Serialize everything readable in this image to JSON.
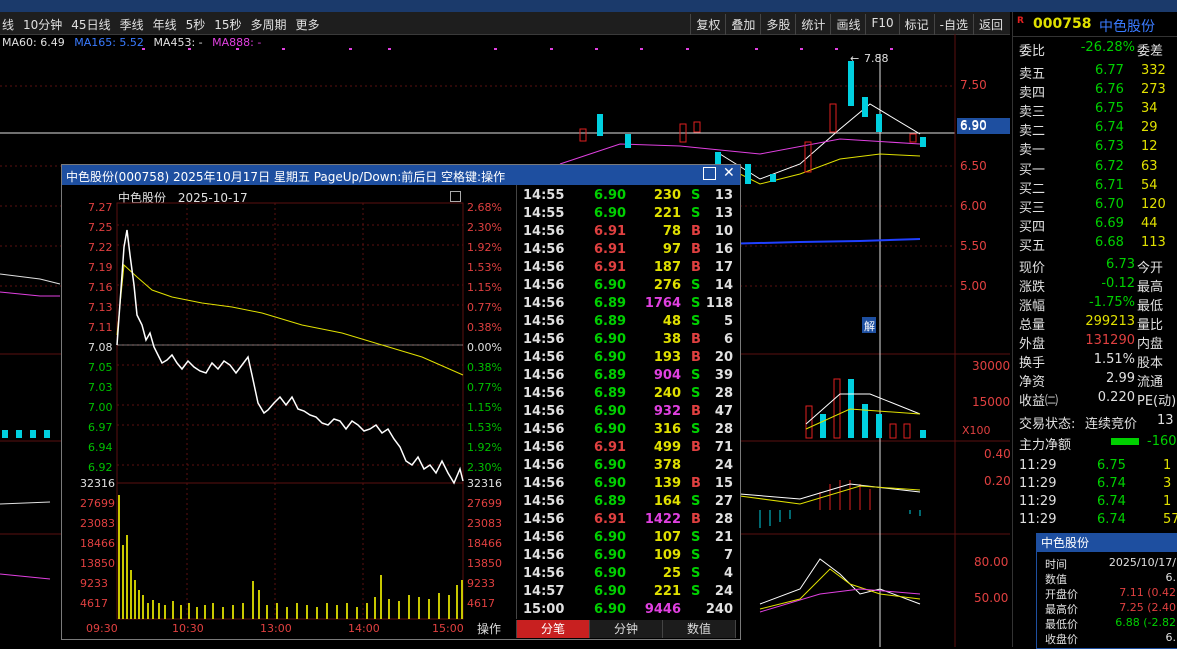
{
  "toolbar": {
    "left_items": [
      "线",
      "10分钟",
      "45日线",
      "季线",
      "年线",
      "5秒",
      "15秒",
      "多周期",
      "更多"
    ],
    "right_items": [
      "复权",
      "叠加",
      "多股",
      "统计",
      "画线",
      "F10",
      "标记",
      "-自选",
      "返回"
    ]
  },
  "ma_line": {
    "ma60": "MA60: 6.49",
    "ma165": "MA165: 5.52",
    "ma453": "MA453: -",
    "ma888": "MA888: -"
  },
  "main_chart": {
    "price_labels": [
      "7.50",
      "6.90",
      "6.50",
      "6.00",
      "5.50",
      "5.00"
    ],
    "high_label": "7.88",
    "vol_labels": [
      "30000",
      "15000",
      "X100"
    ],
    "macd_labels": [
      "0.40",
      "0.20"
    ],
    "kdj_labels": [
      "80.00",
      "50.00"
    ],
    "jie_label": "解"
  },
  "popup": {
    "title": "中色股份(000758) 2025年10月17日 星期五 PageUp/Down:前后日 空格键:操作",
    "subtitle_name": "中色股份",
    "subtitle_date": "2025-10-17",
    "left_prices": [
      "7.27",
      "7.25",
      "7.22",
      "7.19",
      "7.16",
      "7.13",
      "7.11",
      "7.08",
      "7.05",
      "7.03",
      "7.00",
      "6.97",
      "6.94",
      "6.92"
    ],
    "right_pcts": [
      "2.68%",
      "2.30%",
      "1.92%",
      "1.53%",
      "1.15%",
      "0.77%",
      "0.38%",
      "0.00%",
      "0.38%",
      "0.77%",
      "1.15%",
      "1.53%",
      "1.92%",
      "2.30%"
    ],
    "vol_labels": [
      "32316",
      "27699",
      "23083",
      "18466",
      "13850",
      "9233",
      "4617"
    ],
    "time_labels": [
      "09:30",
      "10:30",
      "13:00",
      "14:00",
      "15:00"
    ],
    "ticks": [
      [
        "14:55",
        "6.90",
        "230",
        "S",
        "13"
      ],
      [
        "14:55",
        "6.90",
        "221",
        "S",
        "13"
      ],
      [
        "14:56",
        "6.91",
        "78",
        "B",
        "10"
      ],
      [
        "14:56",
        "6.91",
        "97",
        "B",
        "16"
      ],
      [
        "14:56",
        "6.91",
        "187",
        "B",
        "17"
      ],
      [
        "14:56",
        "6.90",
        "276",
        "S",
        "14"
      ],
      [
        "14:56",
        "6.89",
        "1764",
        "S",
        "118"
      ],
      [
        "14:56",
        "6.89",
        "48",
        "S",
        "5"
      ],
      [
        "14:56",
        "6.90",
        "38",
        "B",
        "6"
      ],
      [
        "14:56",
        "6.90",
        "193",
        "B",
        "20"
      ],
      [
        "14:56",
        "6.89",
        "904",
        "S",
        "39"
      ],
      [
        "14:56",
        "6.89",
        "240",
        "S",
        "28"
      ],
      [
        "14:56",
        "6.90",
        "932",
        "B",
        "47"
      ],
      [
        "14:56",
        "6.90",
        "316",
        "S",
        "28"
      ],
      [
        "14:56",
        "6.91",
        "499",
        "B",
        "71"
      ],
      [
        "14:56",
        "6.90",
        "378",
        "",
        "24"
      ],
      [
        "14:56",
        "6.90",
        "139",
        "B",
        "15"
      ],
      [
        "14:56",
        "6.89",
        "164",
        "S",
        "27"
      ],
      [
        "14:56",
        "6.91",
        "1422",
        "B",
        "28"
      ],
      [
        "14:56",
        "6.90",
        "107",
        "S",
        "21"
      ],
      [
        "14:56",
        "6.90",
        "109",
        "S",
        "7"
      ],
      [
        "14:56",
        "6.90",
        "25",
        "S",
        "4"
      ],
      [
        "14:57",
        "6.90",
        "221",
        "S",
        "24"
      ],
      [
        "15:00",
        "6.90",
        "9446",
        "",
        "240"
      ]
    ],
    "tabs": [
      "操作",
      "分笔",
      "分钟",
      "数值"
    ]
  },
  "right_panel": {
    "code": "000758",
    "name": "中色股份",
    "wei_bi_label": "委比",
    "wei_bi": "-26.28%",
    "wei_cha_label": "委差",
    "asks": [
      [
        "卖五",
        "6.77",
        "332"
      ],
      [
        "卖四",
        "6.76",
        "273"
      ],
      [
        "卖三",
        "6.75",
        "34"
      ],
      [
        "卖二",
        "6.74",
        "29"
      ],
      [
        "卖一",
        "6.73",
        "12"
      ]
    ],
    "bids": [
      [
        "买一",
        "6.72",
        "63"
      ],
      [
        "买二",
        "6.71",
        "54"
      ],
      [
        "买三",
        "6.70",
        "120"
      ],
      [
        "买四",
        "6.69",
        "44"
      ],
      [
        "买五",
        "6.68",
        "113"
      ]
    ],
    "stats": [
      [
        "现价",
        "6.73",
        "今开"
      ],
      [
        "涨跌",
        "-0.12",
        "最高"
      ],
      [
        "涨幅",
        "-1.75%",
        "最低"
      ],
      [
        "总量",
        "299213",
        "量比"
      ],
      [
        "外盘",
        "131290",
        "内盘"
      ],
      [
        "换手",
        "1.51%",
        "股本"
      ],
      [
        "净资",
        "2.99",
        "流通"
      ],
      [
        "收益㈡",
        "0.220",
        "PE(动)"
      ]
    ],
    "status_label": "交易状态:",
    "status_value": "连续竞价",
    "status_time": "13",
    "main_force_label": "主力净额",
    "main_force_value": "-160",
    "trades": [
      [
        "11:29",
        "6.75",
        "1"
      ],
      [
        "11:29",
        "6.74",
        "3"
      ],
      [
        "11:29",
        "6.74",
        "1"
      ],
      [
        "11:29",
        "6.74",
        "57"
      ]
    ],
    "price_line_label": "6.90"
  },
  "tooltip": {
    "title": "中色股份",
    "rows": [
      [
        "时间",
        "2025/10/17/"
      ],
      [
        "数值",
        "6."
      ],
      [
        "开盘价",
        "7.11 (0.42"
      ],
      [
        "最高价",
        "7.25 (2.40"
      ],
      [
        "最低价",
        "6.88 (-2.82"
      ],
      [
        "收盘价",
        "6."
      ]
    ]
  }
}
